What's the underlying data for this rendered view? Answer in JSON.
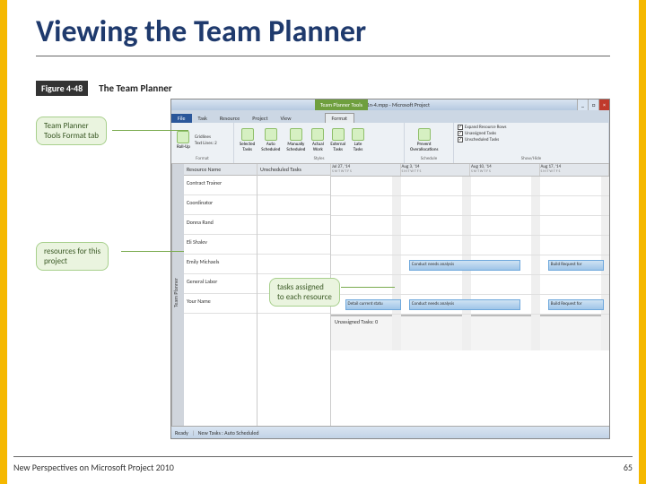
{
  "slide": {
    "title": "Viewing the Team Planner"
  },
  "figure": {
    "number": "Figure 4-48",
    "name": "The Team Planner"
  },
  "callouts": {
    "format_tab": "Team Planner\nTools Format tab",
    "resources": "resources for this\nproject",
    "tasks": "tasks assigned\nto each resource"
  },
  "app": {
    "context_tab": "Team Planner Tools",
    "doc_title": "NewAV1n-4.mpp - Microsoft Project",
    "tabs": {
      "file": "File",
      "task": "Task",
      "resource": "Resource",
      "project": "Project",
      "view": "View",
      "format": "Format"
    },
    "ribbon": {
      "format": {
        "gridlines": "Gridlines",
        "textlines": "Text Lines: 2",
        "rollup": "Roll-Up",
        "selected": "Selected\nTasks",
        "auto": "Auto\nScheduled",
        "manual": "Manually\nScheduled",
        "actual": "Actual\nWork",
        "external": "External\nTasks",
        "late": "Late\nTasks",
        "prevent": "Prevent\nOverallocations",
        "expand": "Expand Resource Rows",
        "unassigned_chk": "Unassigned Tasks",
        "unsched_chk": "Unscheduled Tasks",
        "g_format": "Format",
        "g_styles": "Styles",
        "g_schedule": "Schedule",
        "g_showhide": "Show/Hide"
      }
    },
    "grid": {
      "resource_header": "Resource Name",
      "unscheduled_header": "Unscheduled Tasks",
      "resources": [
        "Contract Trainer",
        "Coordinator",
        "Donna Rand",
        "Eli Shalev",
        "Emily Michaels",
        "General Labor",
        "Your Name"
      ],
      "weeks": [
        {
          "date": "Jul 27, '14",
          "days": "S M T W T F S"
        },
        {
          "date": "Aug 3, '14",
          "days": "S M T W T F S"
        },
        {
          "date": "Aug 10, '14",
          "days": "S M T W T F S"
        },
        {
          "date": "Aug 17, '14",
          "days": "S M T W T F S"
        }
      ],
      "tasks": {
        "emily_1": "Conduct needs analysis",
        "emily_2": "Build Request for",
        "your_0": "Detail current statu",
        "your_1": "Conduct needs analysis",
        "your_2": "Build Request for"
      },
      "unassigned": "Unassigned Tasks: 0"
    },
    "status": {
      "ready": "Ready",
      "newtasks": "New Tasks : Auto Scheduled"
    }
  },
  "footer": {
    "left": "New Perspectives on Microsoft Project 2010",
    "page": "65"
  },
  "win": {
    "min": "_",
    "max": "□",
    "close": "×"
  }
}
